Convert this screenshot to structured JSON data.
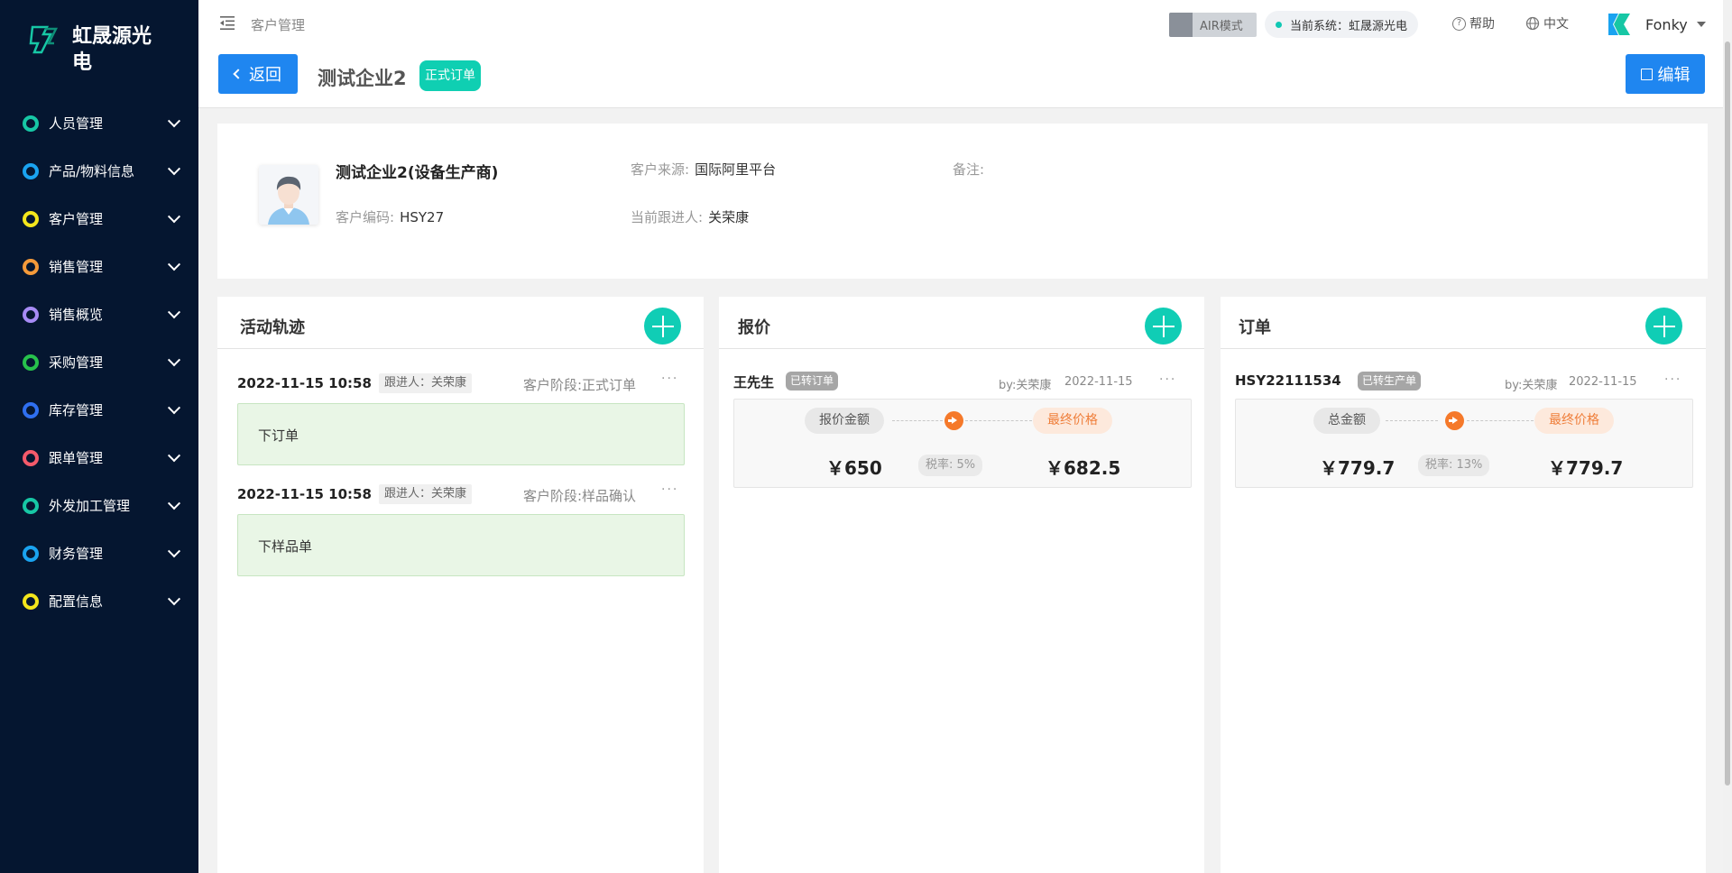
{
  "sidebar": {
    "brand": "虹晟源光电",
    "items": [
      {
        "label": "人员管理",
        "color": "#17c7a5"
      },
      {
        "label": "产品/物料信息",
        "color": "#1aa3f0"
      },
      {
        "label": "客户管理",
        "color": "#f4e61c"
      },
      {
        "label": "销售管理",
        "color": "#f59a3a"
      },
      {
        "label": "销售概览",
        "color": "#a78bf5"
      },
      {
        "label": "采购管理",
        "color": "#27c24c"
      },
      {
        "label": "库存管理",
        "color": "#2f6ff0"
      },
      {
        "label": "跟单管理",
        "color": "#f55a6b"
      },
      {
        "label": "外发加工管理",
        "color": "#17c7a5"
      },
      {
        "label": "财务管理",
        "color": "#1aa3f0"
      },
      {
        "label": "配置信息",
        "color": "#f4e61c"
      }
    ]
  },
  "header": {
    "breadcrumb": "客户管理",
    "air_mode": "AIR模式",
    "current_system": "当前系统：虹晟源光电",
    "help": "帮助",
    "language": "中文",
    "username": "Fonky",
    "back_label": "返回",
    "title": "测试企业2",
    "status": "正式订单",
    "edit_label": "编辑"
  },
  "customer": {
    "name": "测试企业2(设备生产商)",
    "code_label": "客户编码:",
    "code": "HSY27",
    "source_label": "客户来源:",
    "source": "国际阿里平台",
    "follower_label": "当前跟进人:",
    "follower": "关荣康",
    "remark_label": "备注:",
    "remark": ""
  },
  "activity": {
    "title": "活动轨迹",
    "items": [
      {
        "time": "2022-11-15 10:58",
        "follower": "跟进人：关荣康",
        "stage": "客户阶段:正式订单",
        "content": "下订单"
      },
      {
        "time": "2022-11-15 10:58",
        "follower": "跟进人：关荣康",
        "stage": "客户阶段:样品确认",
        "content": "下样品单"
      }
    ]
  },
  "quote": {
    "title": "报价",
    "name": "王先生",
    "tag": "已转订单",
    "by": "by:关荣康",
    "date": "2022-11-15",
    "amount_label": "报价金额",
    "final_label": "最终价格",
    "amount": "￥650",
    "tax": "税率: 5%",
    "final": "￥682.5"
  },
  "order": {
    "title": "订单",
    "code": "HSY22111534",
    "tag": "已转生产单",
    "by": "by:关荣康",
    "date": "2022-11-15",
    "amount_label": "总金额",
    "final_label": "最终价格",
    "amount": "￥779.7",
    "tax": "税率: 13%",
    "final": "￥779.7"
  },
  "more": "···"
}
